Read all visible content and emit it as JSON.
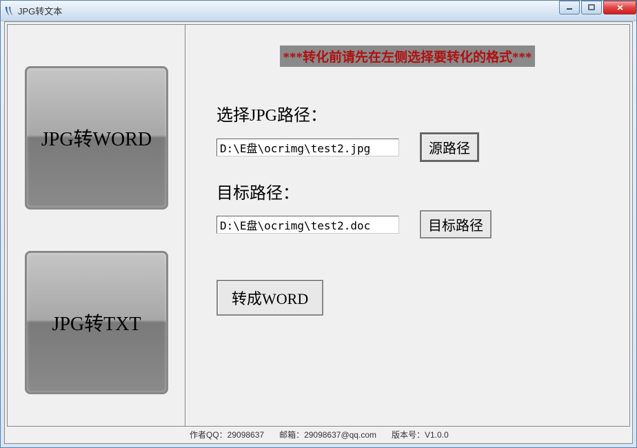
{
  "window": {
    "title": "JPG转文本"
  },
  "sidebar": {
    "modes": [
      {
        "label": "JPG转WORD"
      },
      {
        "label": "JPG转TXT"
      }
    ]
  },
  "main": {
    "instruction": "***转化前请先在左侧选择要转化的格式***",
    "source": {
      "label": "选择JPG路径：",
      "value": "D:\\E盘\\ocrimg\\test2.jpg",
      "button": "源路径"
    },
    "target": {
      "label": "目标路径：",
      "value": "D:\\E盘\\ocrimg\\test2.doc",
      "button": "目标路径"
    },
    "convert_label": "转成WORD"
  },
  "status": {
    "qq": "作者QQ：29098637",
    "email": "邮箱：29098637@qq.com",
    "version": "版本号：V1.0.0"
  }
}
